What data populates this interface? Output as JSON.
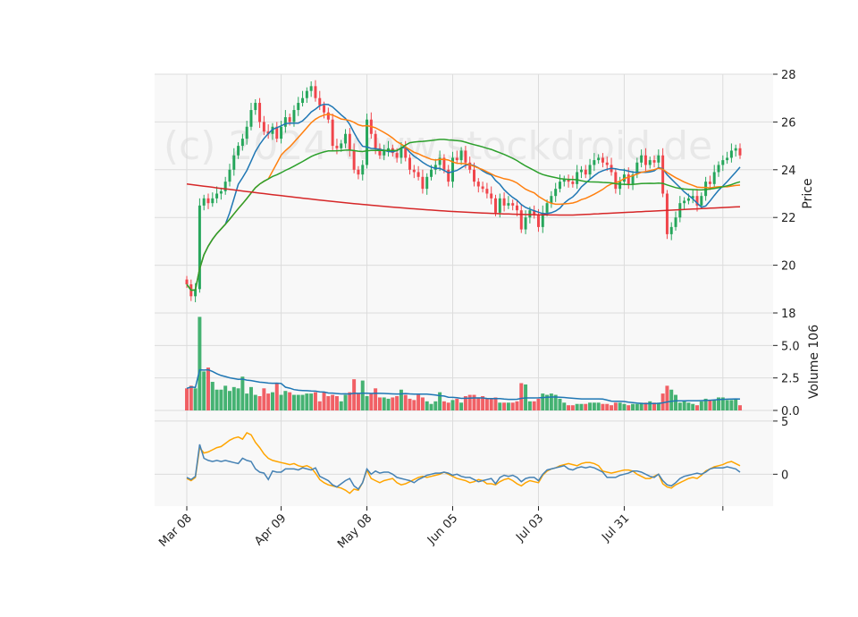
{
  "chart_data": {
    "type": "candlestick",
    "watermark": "(c) 2024 www.stockdroid.de",
    "x_tick_labels": [
      "Mar 08",
      "Apr 09",
      "May 08",
      "Jun 05",
      "Jul 03",
      "Jul 31"
    ],
    "price_panel": {
      "ylabel": "Price",
      "ylim": [
        18,
        28
      ],
      "yticks": [
        18,
        20,
        22,
        24,
        26,
        28
      ],
      "colors": {
        "up": "#26a65b",
        "down": "#f0454b",
        "ma_fast": "#1f77b4",
        "ma_mid": "#ff7f0e",
        "ma_slow": "#2ca02c",
        "ma_long": "#d62728"
      }
    },
    "volume_panel": {
      "ylabel": "Volume",
      "ylabel_exponent": "10^6",
      "ylim": [
        0,
        7.5
      ],
      "yticks": [
        "0.0",
        "2.5",
        "5.0"
      ],
      "ma_color": "#1f77b4"
    },
    "indicator_panel": {
      "yticks": [
        "0",
        "5"
      ],
      "ylim": [
        -3,
        6
      ],
      "colors": {
        "line1": "#4682b4",
        "line2": "#ffa500"
      }
    },
    "close": [
      19.2,
      18.7,
      19.0,
      22.5,
      22.8,
      22.6,
      22.8,
      23.0,
      23.1,
      23.5,
      24.0,
      24.6,
      25.0,
      25.3,
      25.8,
      26.5,
      26.8,
      26.0,
      25.6,
      25.5,
      25.8,
      25.3,
      25.8,
      26.2,
      26.0,
      26.5,
      26.8,
      27.0,
      27.3,
      27.5,
      27.0,
      26.7,
      26.4,
      26.1,
      25.0,
      24.9,
      25.1,
      25.5,
      24.8,
      24.0,
      23.8,
      24.2,
      26.1,
      25.5,
      24.9,
      24.6,
      24.8,
      24.9,
      24.7,
      24.5,
      24.9,
      24.5,
      24.0,
      23.9,
      23.7,
      23.2,
      23.7,
      24.0,
      24.2,
      24.5,
      24.0,
      23.5,
      24.5,
      24.4,
      24.8,
      24.3,
      24.0,
      23.5,
      23.3,
      23.2,
      23.0,
      22.8,
      22.2,
      22.8,
      22.5,
      22.6,
      22.5,
      22.3,
      21.5,
      22.0,
      22.3,
      22.1,
      21.6,
      22.2,
      22.6,
      22.9,
      23.2,
      23.5,
      23.6,
      23.5,
      23.4,
      23.9,
      24.0,
      23.8,
      24.2,
      24.4,
      24.5,
      24.3,
      24.2,
      23.9,
      23.2,
      23.5,
      23.8,
      23.4,
      23.8,
      24.3,
      24.6,
      24.2,
      24.4,
      24.3,
      24.6,
      23.0,
      21.3,
      21.6,
      22.0,
      22.6,
      22.7,
      22.8,
      22.9,
      22.5,
      22.9,
      23.5,
      23.4,
      23.9,
      24.2,
      24.4,
      24.5,
      24.8,
      24.9,
      24.6
    ],
    "volume": [
      1.7,
      1.9,
      1.7,
      7.2,
      3.0,
      3.3,
      2.2,
      1.6,
      1.6,
      1.9,
      1.5,
      1.8,
      1.7,
      2.6,
      1.3,
      1.8,
      1.2,
      1.1,
      1.7,
      1.3,
      1.4,
      2.1,
      1.2,
      1.5,
      1.4,
      1.2,
      1.2,
      1.2,
      1.3,
      1.3,
      1.4,
      0.7,
      1.4,
      1.1,
      1.2,
      1.1,
      0.7,
      1.2,
      1.4,
      2.4,
      1.3,
      2.3,
      1.1,
      1.3,
      1.7,
      1.0,
      1.0,
      0.9,
      1.0,
      1.1,
      1.6,
      1.2,
      0.9,
      0.8,
      1.2,
      1.0,
      0.7,
      0.5,
      0.7,
      1.4,
      0.7,
      0.6,
      0.8,
      0.9,
      0.6,
      1.1,
      1.2,
      1.2,
      1.0,
      1.1,
      0.9,
      0.9,
      1.0,
      0.6,
      0.6,
      0.6,
      0.6,
      0.7,
      2.1,
      2.0,
      0.7,
      0.7,
      0.9,
      1.3,
      1.2,
      1.3,
      1.2,
      0.9,
      0.6,
      0.4,
      0.4,
      0.5,
      0.5,
      0.5,
      0.6,
      0.6,
      0.6,
      0.5,
      0.5,
      0.4,
      0.6,
      0.6,
      0.5,
      0.4,
      0.5,
      0.5,
      0.6,
      0.6,
      0.7,
      0.6,
      0.6,
      1.3,
      1.9,
      1.6,
      1.2,
      0.6,
      0.7,
      0.6,
      0.5,
      0.4,
      0.7,
      0.9,
      0.8,
      0.8,
      1.0,
      1.0,
      0.8,
      0.8,
      0.9,
      0.4
    ],
    "indicator_line1": [
      -0.3,
      -0.5,
      -0.2,
      2.8,
      1.5,
      1.3,
      1.2,
      1.3,
      1.2,
      1.3,
      1.2,
      1.1,
      1.0,
      1.5,
      1.3,
      1.2,
      0.5,
      0.2,
      0.1,
      -0.5,
      0.3,
      0.2,
      0.2,
      0.5,
      0.5,
      0.5,
      0.4,
      0.6,
      0.5,
      0.4,
      0.6,
      -0.2,
      -0.4,
      -0.6,
      -1.0,
      -1.2,
      -0.9,
      -0.6,
      -0.4,
      -1.1,
      -1.4,
      -0.8,
      0.5,
      0.0,
      0.3,
      0.1,
      0.2,
      0.2,
      0.0,
      -0.3,
      -0.4,
      -0.5,
      -0.6,
      -0.8,
      -0.5,
      -0.3,
      -0.1,
      0.0,
      0.1,
      0.1,
      0.2,
      0.1,
      -0.1,
      0.0,
      -0.2,
      -0.3,
      -0.3,
      -0.5,
      -0.7,
      -0.6,
      -0.5,
      -0.4,
      -0.9,
      -0.3,
      -0.1,
      -0.2,
      -0.1,
      -0.3,
      -0.7,
      -0.4,
      -0.3,
      -0.3,
      -0.6,
      0.0,
      0.4,
      0.5,
      0.6,
      0.7,
      0.8,
      0.5,
      0.4,
      0.6,
      0.7,
      0.6,
      0.7,
      0.6,
      0.4,
      0.2,
      -0.3,
      -0.3,
      -0.3,
      -0.1,
      0.0,
      0.1,
      0.3,
      0.3,
      0.2,
      0.0,
      -0.2,
      -0.3,
      0.0,
      -0.6,
      -1.0,
      -1.1,
      -0.8,
      -0.4,
      -0.2,
      -0.1,
      0.0,
      0.1,
      0.0,
      0.2,
      0.5,
      0.6,
      0.6,
      0.6,
      0.7,
      0.6,
      0.5,
      0.2
    ],
    "indicator_line2": [
      -0.4,
      -0.6,
      -0.3,
      2.5,
      2.0,
      2.1,
      2.3,
      2.5,
      2.6,
      2.9,
      3.2,
      3.4,
      3.5,
      3.3,
      3.9,
      3.7,
      3.0,
      2.5,
      1.9,
      1.5,
      1.3,
      1.2,
      1.1,
      1.0,
      0.9,
      1.0,
      0.8,
      0.7,
      0.8,
      0.6,
      0.1,
      -0.5,
      -0.8,
      -1.0,
      -1.1,
      -1.2,
      -1.3,
      -1.5,
      -1.8,
      -1.4,
      -1.5,
      -0.8,
      0.4,
      -0.4,
      -0.6,
      -0.8,
      -0.6,
      -0.5,
      -0.4,
      -0.8,
      -1.0,
      -0.9,
      -0.7,
      -0.5,
      -0.3,
      -0.2,
      -0.3,
      -0.2,
      -0.1,
      0.0,
      0.2,
      0.0,
      -0.2,
      -0.4,
      -0.5,
      -0.6,
      -0.8,
      -0.7,
      -0.5,
      -0.6,
      -0.9,
      -0.9,
      -1.0,
      -0.7,
      -0.5,
      -0.4,
      -0.6,
      -0.9,
      -1.1,
      -0.8,
      -0.6,
      -0.7,
      -0.8,
      -0.1,
      0.3,
      0.5,
      0.6,
      0.8,
      0.9,
      1.0,
      0.9,
      0.8,
      1.0,
      1.1,
      1.1,
      1.0,
      0.8,
      0.3,
      0.2,
      0.1,
      0.2,
      0.3,
      0.4,
      0.4,
      0.3,
      0.0,
      -0.2,
      -0.4,
      -0.4,
      -0.2,
      0.0,
      -0.9,
      -1.2,
      -1.3,
      -1.0,
      -0.8,
      -0.6,
      -0.4,
      -0.3,
      -0.4,
      -0.1,
      0.3,
      0.5,
      0.7,
      0.8,
      0.9,
      1.1,
      1.2,
      1.0,
      0.8
    ]
  }
}
